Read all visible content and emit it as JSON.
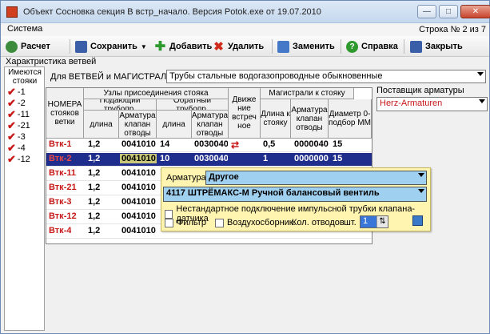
{
  "window": {
    "title": "Объект Сосновка секция В встр_начало. Версия Potok.exe от 19.07.2010",
    "controls": [
      "—",
      "□",
      "✕"
    ]
  },
  "menu": {
    "system": "Система",
    "row_counter": "Строка № 2 из 7"
  },
  "toolbar": {
    "calc": "Расчет",
    "save": "Сохранить",
    "add": "Добавить",
    "delete": "Удалить",
    "replace": "Заменить",
    "help": "Справка",
    "close": "Закрыть"
  },
  "section_title": "Характристика ветвей",
  "risers_panel": {
    "header": "Имеются стояки",
    "items": [
      "-1",
      "-2",
      "-11",
      "-21",
      "-3",
      "-4",
      "-12"
    ]
  },
  "filter": {
    "label": "Для  ВЕТВЕЙ и МАГИСТРАЛЕЙ",
    "value": "Трубы стальные водогазопроводные обыкновенные"
  },
  "supplier": {
    "label": "Поставщик арматуры",
    "value": "Herz-Armaturen"
  },
  "grid": {
    "headers": {
      "riser_no": "НОМЕРА стояков ветки",
      "connection_nodes": "Узлы присоединения стояка",
      "supply": "Подающий трубопр.",
      "return": "Обратный трубопр.",
      "length": "длина",
      "fitting": "Арматура клапан отводы",
      "counter_flow": "Движе ние встреч ное",
      "mains": "Магистрали к стояку",
      "length_to_riser": "Длина к стояку",
      "diameter": "Диаметр 0-подбор ММ"
    },
    "rows": [
      {
        "riser": "Втк-1",
        "supply_len": "1,2",
        "supply_fit": "0041010",
        "return_len": "14",
        "return_fit": "0030040",
        "counter": "⇄",
        "main_len": "0,5",
        "main_fit": "0000040",
        "diameter": "15"
      },
      {
        "riser": "Втк-2",
        "supply_len": "1,2",
        "supply_fit": "0041010",
        "return_len": "10",
        "return_fit": "0030040",
        "counter": "",
        "main_len": "1",
        "main_fit": "0000000",
        "diameter": "15"
      },
      {
        "riser": "Втк-11",
        "supply_len": "1,2",
        "supply_fit": "0041010",
        "return_len": "",
        "return_fit": "",
        "counter": "",
        "main_len": "",
        "main_fit": "",
        "diameter": ""
      },
      {
        "riser": "Втк-21",
        "supply_len": "1,2",
        "supply_fit": "0041010",
        "return_len": "",
        "return_fit": "",
        "counter": "",
        "main_len": "",
        "main_fit": "",
        "diameter": ""
      },
      {
        "riser": "Втк-3",
        "supply_len": "1,2",
        "supply_fit": "0041010",
        "return_len": "",
        "return_fit": "",
        "counter": "",
        "main_len": "",
        "main_fit": "",
        "diameter": ""
      },
      {
        "riser": "Втк-12",
        "supply_len": "1,2",
        "supply_fit": "0041010",
        "return_len": "",
        "return_fit": "",
        "counter": "",
        "main_len": "",
        "main_fit": "",
        "diameter": ""
      },
      {
        "riser": "Втк-4",
        "supply_len": "1,2",
        "supply_fit": "0041010",
        "return_len": "",
        "return_fit": "",
        "counter": "",
        "main_len": "",
        "main_fit": "",
        "diameter": ""
      }
    ]
  },
  "popup": {
    "fitting_label": "Арматура",
    "fitting_type": "Другое",
    "fitting_item": "4117 ШТРЁМАКС-М Ручной балансовый вентиль",
    "nonstandard_label": "Нестандартное подключение импульсной трубки клапана-датчика",
    "filter_label": "Фильтр",
    "air_vent_label": "Воздухосборник.",
    "outlet_count_label": "Кол. отводов",
    "unit": "шт.",
    "outlet_count": "1"
  },
  "colors": {
    "selected_row": "#1f2d8c",
    "riser_text": "#c81818",
    "popup_bg": "#fff4b0",
    "supplier_text": "#c81818"
  }
}
